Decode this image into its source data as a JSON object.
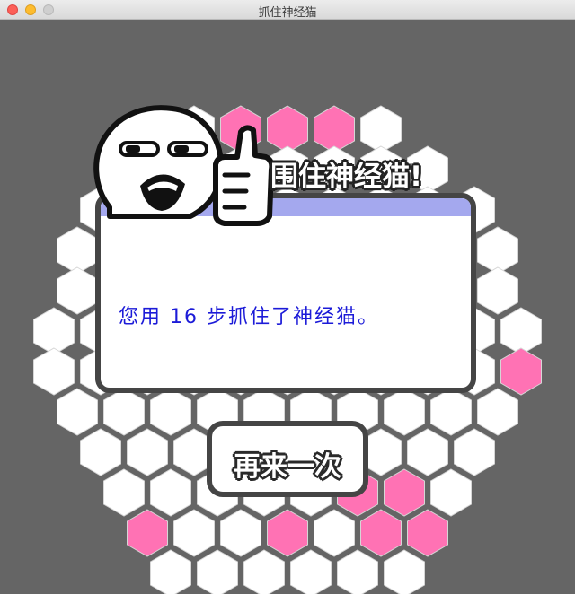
{
  "window": {
    "title": "抓住神经猫"
  },
  "colors": {
    "background": "#656565",
    "cell_empty": "#ffffff",
    "cell_wall": "#ff72b4",
    "dialog_band": "#a4a8ee",
    "message": "#1c1bd8"
  },
  "board": {
    "rows": [
      {
        "cells": [
          "empty",
          "wall",
          "wall",
          "wall",
          "empty"
        ]
      },
      {
        "cells": [
          "empty",
          "empty",
          "empty",
          "empty",
          "empty",
          "empty",
          "empty"
        ]
      },
      {
        "cells": [
          "empty",
          "empty",
          "empty",
          "empty",
          "empty",
          "empty",
          "empty",
          "empty",
          "empty"
        ]
      },
      {
        "cells": [
          "empty",
          "empty",
          "empty",
          "empty",
          "empty",
          "empty",
          "empty",
          "empty",
          "empty",
          "empty"
        ]
      },
      {
        "cells": [
          "empty",
          "empty",
          "empty",
          "empty",
          "empty",
          "empty",
          "empty",
          "empty",
          "empty",
          "empty"
        ]
      },
      {
        "cells": [
          "empty",
          "empty",
          "empty",
          "empty",
          "empty",
          "empty",
          "empty",
          "empty",
          "empty",
          "empty",
          "empty"
        ]
      },
      {
        "cells": [
          "empty",
          "empty",
          "empty",
          "empty",
          "empty",
          "empty",
          "empty",
          "empty",
          "empty",
          "empty",
          "wall"
        ]
      },
      {
        "cells": [
          "empty",
          "empty",
          "empty",
          "empty",
          "empty",
          "empty",
          "empty",
          "empty",
          "empty",
          "empty"
        ]
      },
      {
        "cells": [
          "empty",
          "empty",
          "empty",
          "empty",
          "empty",
          "empty",
          "empty",
          "empty",
          "empty"
        ]
      },
      {
        "cells": [
          "empty",
          "empty",
          "empty",
          "empty",
          "empty",
          "wall",
          "wall",
          "empty"
        ]
      },
      {
        "cells": [
          "wall",
          "empty",
          "empty",
          "wall",
          "empty",
          "wall",
          "wall"
        ]
      },
      {
        "cells": [
          "empty",
          "empty",
          "empty",
          "empty",
          "empty",
          "empty"
        ]
      }
    ]
  },
  "result": {
    "headline": "围住神经猫!",
    "message": "您用 16 步抓住了神经猫。",
    "steps": 16
  },
  "actions": {
    "replay_label": "再来一次"
  }
}
